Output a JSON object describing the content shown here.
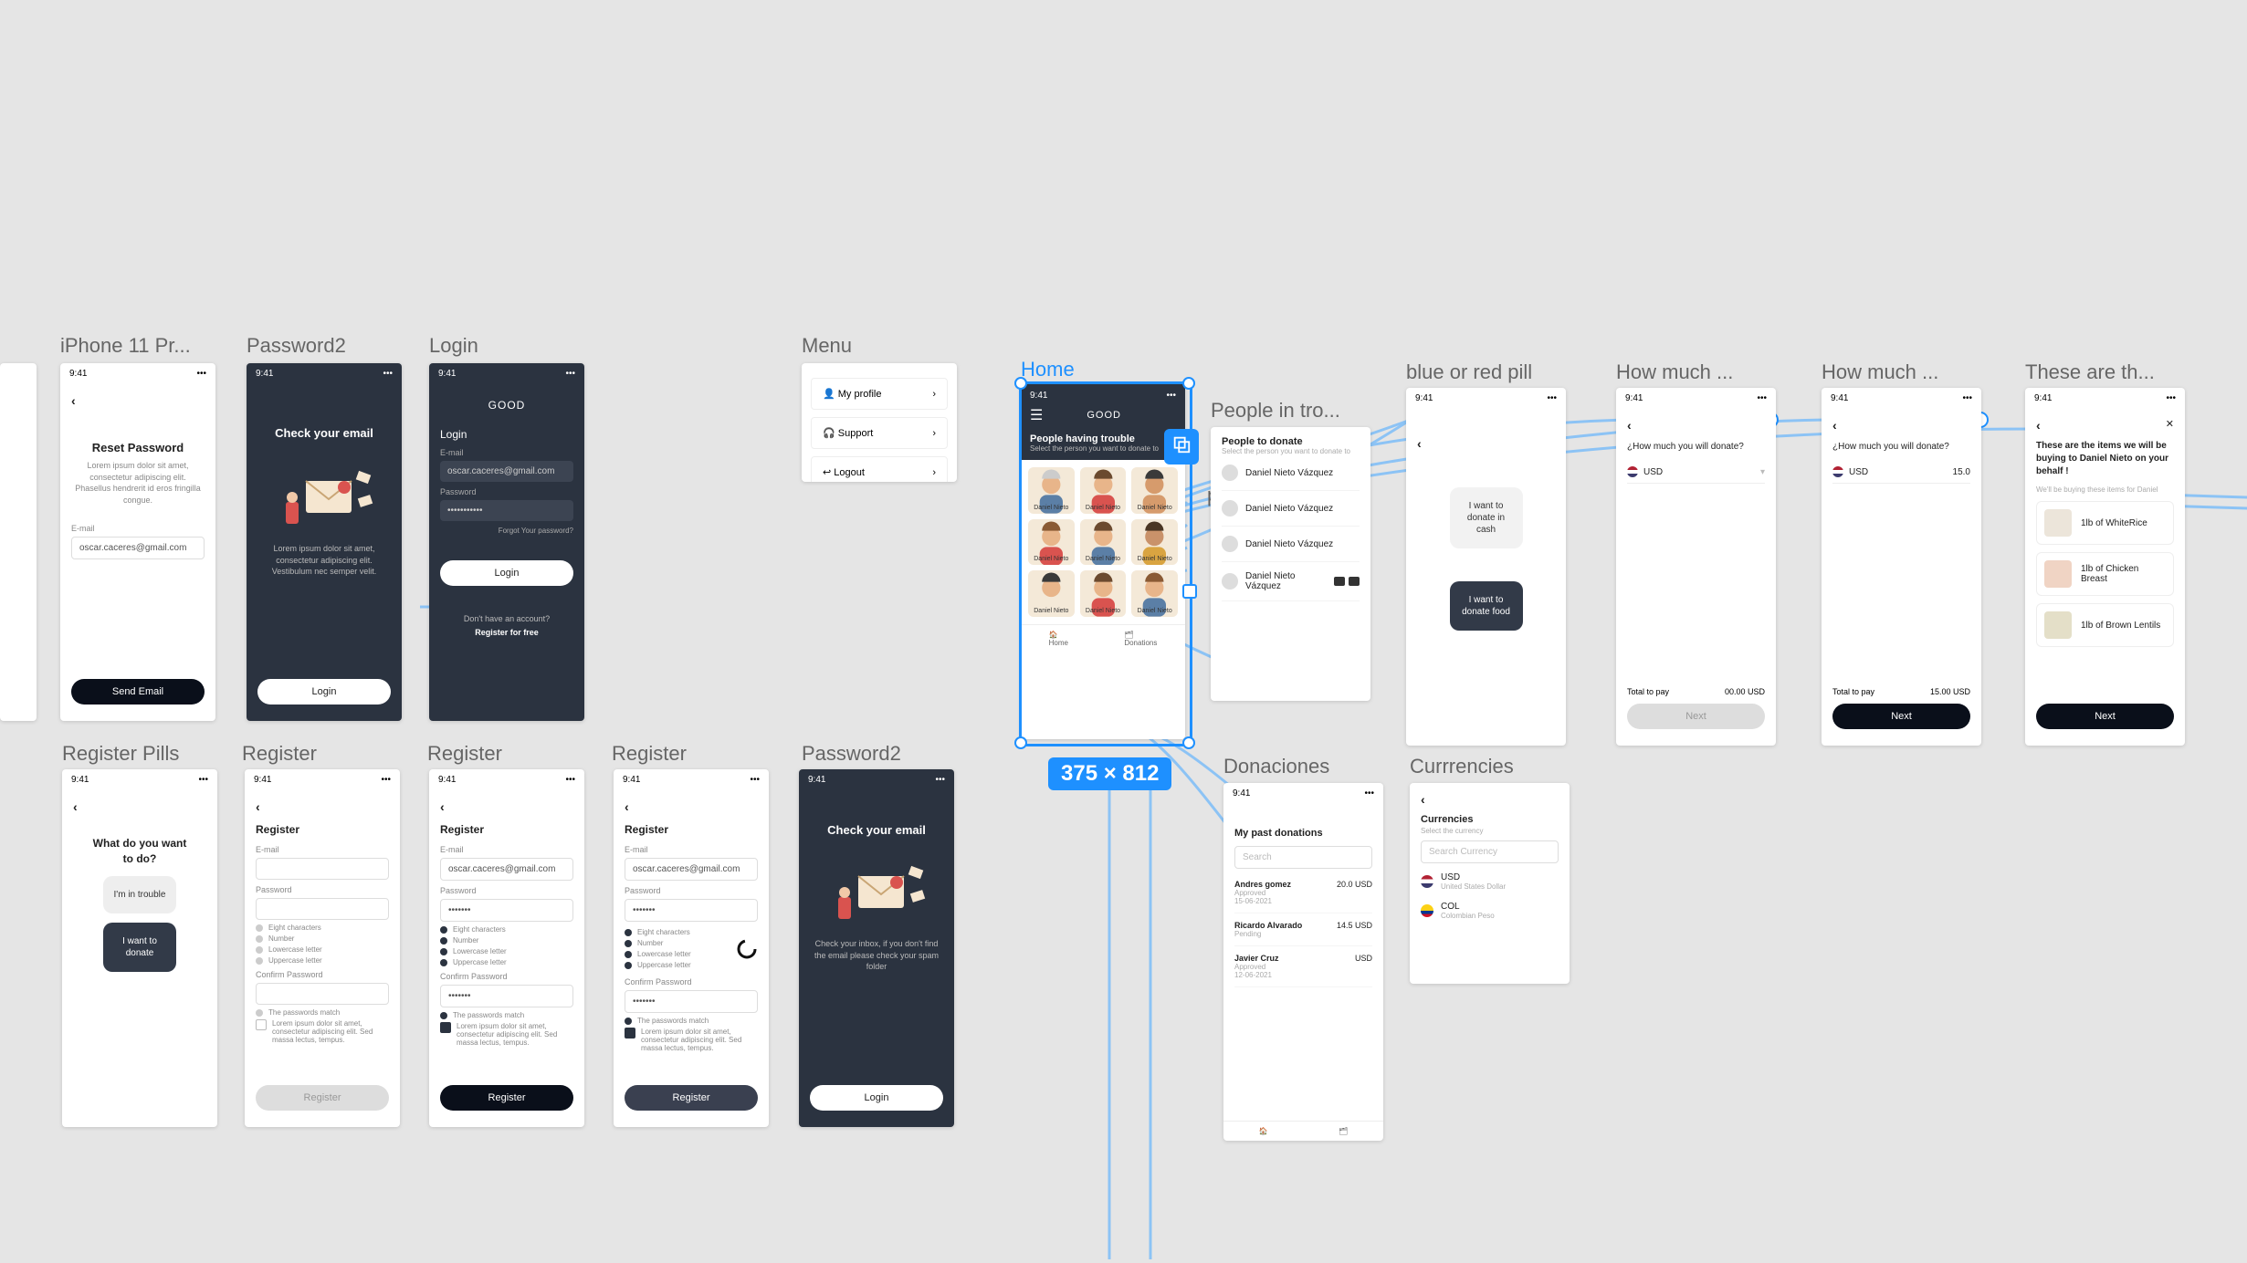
{
  "status_time": "9:41",
  "labels": {
    "iphone": "iPhone 11 Pr...",
    "pw2a": "Password2",
    "login": "Login",
    "menu": "Menu",
    "home": "Home",
    "people": "People in tro...",
    "person_outline": "person_outline",
    "blue": "blue or red pill",
    "hm1": "How much ...",
    "hm2": "How much ...",
    "these": "These are th...",
    "regpills": "Register Pills",
    "reg1": "Register",
    "reg2": "Register",
    "reg3": "Register",
    "pw2b": "Password2",
    "donac": "Donaciones",
    "curr": "Currrencies"
  },
  "reset": {
    "title": "Reset Password",
    "sub": "Lorem ipsum dolor sit amet, consectetur adipiscing elit. Phasellus hendrerit id eros fringilla congue.",
    "email_lbl": "E-mail",
    "email": "oscar.caceres@gmail.com",
    "btn": "Send Email"
  },
  "check": {
    "title": "Check your email",
    "sub": "Lorem ipsum dolor sit amet, consectetur adipiscing elit. Vestibulum nec semper velit.",
    "btn": "Login",
    "sub2": "Check your inbox, if you don't find the email please check your spam folder",
    "btn2": "Login"
  },
  "login": {
    "brand": "GOOD",
    "title": "Login",
    "email_lbl": "E-mail",
    "email": "oscar.caceres@gmail.com",
    "pw_lbl": "Password",
    "pw": "•••••••••••",
    "forgot": "Forgot Your password?",
    "btn": "Login",
    "noacct": "Don't have an account?",
    "reg": "Register for free"
  },
  "menu": {
    "profile": "My profile",
    "support": "Support",
    "logout": "Logout"
  },
  "home": {
    "brand": "GOOD",
    "title": "People having trouble",
    "sub": "Select the person you want to donate to",
    "names": [
      "Daniel Nieto",
      "Daniel Nieto",
      "Daniel Nieto",
      "Daniel Nieto",
      "Daniel Nieto",
      "Daniel Nieto",
      "Daniel Nieto",
      "Daniel Nieto",
      "Daniel Nieto"
    ],
    "nav_home": "Home",
    "nav_don": "Donations",
    "dims": "375 × 812"
  },
  "people": {
    "title": "People to donate",
    "sub": "Select the person you want to donate to",
    "name": "Daniel Nieto Vázquez"
  },
  "blue": {
    "cash": "I want to donate in cash",
    "food": "I want to donate food"
  },
  "hm": {
    "q": "¿How much you will donate?",
    "usd": "USD",
    "amt": "15.0",
    "total_lbl": "Total to pay",
    "total1": "00.00 USD",
    "total2": "15.00 USD",
    "btn": "Next"
  },
  "these": {
    "title": "These are the items we will be buying to Daniel Nieto on your behalf !",
    "sub": "We'll be buying these items for Daniel",
    "i1": "1lb of WhiteRice",
    "i2": "1lb of Chicken Breast",
    "i3": "1lb of Brown Lentils",
    "btn": "Next"
  },
  "regp": {
    "title": "What do you want to do?",
    "a": "I'm in trouble",
    "b": "I want to donate"
  },
  "reg": {
    "title": "Register",
    "email_lbl": "E-mail",
    "email": "oscar.caceres@gmail.com",
    "pw_lbl": "Password",
    "pw": "•••••••",
    "r1": "Eight characters",
    "r2": "Number",
    "r3": "Lowercase letter",
    "r4": "Uppercase letter",
    "conf_lbl": "Confirm Password",
    "match": "The passwords match",
    "terms": "Lorem ipsum dolor sit amet, consectetur adipiscing elit. Sed massa lectus, tempus.",
    "btn": "Register"
  },
  "don": {
    "title": "My past donations",
    "search": "Search",
    "r1_name": "Andres gomez",
    "r1_status": "Approved",
    "r1_date": "15-06-2021",
    "r1_amt": "20.0 USD",
    "r2_name": "Ricardo Alvarado",
    "r2_status": "Pending",
    "r2_amt": "14.5 USD",
    "r3_name": "Javier Cruz",
    "r3_status": "Approved",
    "r3_date": "12-06-2021",
    "r3_amt": "USD"
  },
  "cur": {
    "title": "Currencies",
    "sub": "Select the currency",
    "search": "Search Currency",
    "usd": "USD",
    "usd_sub": "United States Dollar",
    "col": "COL",
    "col_sub": "Colombian Peso"
  }
}
